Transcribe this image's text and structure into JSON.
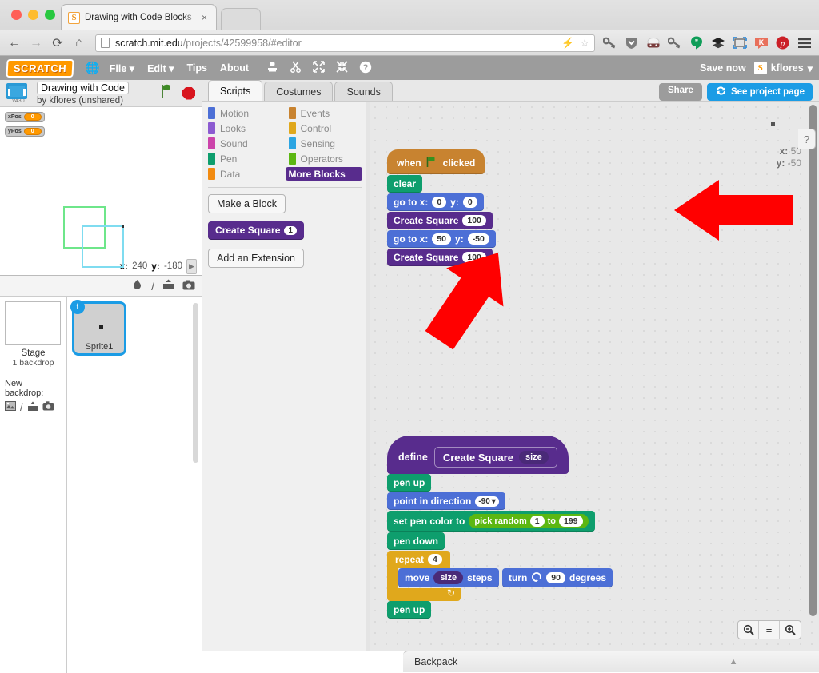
{
  "browser": {
    "tab_title": "Drawing with Code Blocks",
    "tab_favicon": "scratch-favicon",
    "tab_close": "×",
    "url_prefix": "scratch.mit.edu",
    "url_suffix": "/projects/42599958/#editor",
    "nav": {
      "back": "←",
      "forward": "→",
      "reload": "C",
      "home": "⌂"
    },
    "url_actions": {
      "bolt": "⚡",
      "star": "☆"
    },
    "extensions": [
      "key-icon",
      "shield-down-icon",
      "incognito-mask-icon",
      "key-icon-2",
      "hangouts-icon",
      "layers-icon",
      "screenshot-frame-icon",
      "klout-icon",
      "pinterest-icon",
      "menu-icon"
    ]
  },
  "menubar": {
    "logo": "SCRATCH",
    "globe_icon": "globe-icon",
    "items": [
      "File",
      "Edit",
      "Tips",
      "About"
    ],
    "tool_icons": [
      "stamp-icon",
      "scissors-icon",
      "grow-icon",
      "shrink-icon",
      "help-icon"
    ],
    "save_now": "Save now",
    "username": "kflores",
    "user_caret": "▾"
  },
  "stage": {
    "version": "v430",
    "project_title": "Drawing with Code",
    "author_line": "by kflores (unshared)",
    "green_flag": "green-flag-icon",
    "stop_sign": "stop-icon",
    "watchers": [
      {
        "name": "xPos",
        "value": "0"
      },
      {
        "name": "yPos",
        "value": "0"
      }
    ],
    "mouse_x_label": "x:",
    "mouse_x": "240",
    "mouse_y_label": "y:",
    "mouse_y": "-180",
    "drawing": {
      "square_green_color": "#6ee68a",
      "square_cyan_color": "#7fdcf0"
    }
  },
  "sprite_pane": {
    "toolbar_icons": [
      "new-sprite-paint-icon",
      "new-sprite-brush-icon",
      "upload-sprite-icon",
      "camera-sprite-icon"
    ],
    "stage_name": "Stage",
    "stage_sub": "1 backdrop",
    "new_backdrop_label": "New backdrop:",
    "backdrop_icons": [
      "library-backdrop-icon",
      "paint-backdrop-icon",
      "upload-backdrop-icon",
      "camera-backdrop-icon"
    ],
    "sprites": [
      {
        "name": "Sprite1",
        "info_badge": "i",
        "selected": true
      }
    ]
  },
  "editor": {
    "tabs": [
      {
        "label": "Scripts",
        "active": true
      },
      {
        "label": "Costumes",
        "active": false
      },
      {
        "label": "Sounds",
        "active": false
      }
    ],
    "share_button": "Share",
    "project_page_button": "See project page",
    "project_page_icon": "refresh-arrows-icon"
  },
  "palette": {
    "categories": [
      {
        "label": "Motion",
        "color": "#4c6fd6",
        "selected": false
      },
      {
        "label": "Events",
        "color": "#c88330",
        "selected": false
      },
      {
        "label": "Looks",
        "color": "#8c5bd1",
        "selected": false
      },
      {
        "label": "Control",
        "color": "#e0a81c",
        "selected": false
      },
      {
        "label": "Sound",
        "color": "#cc44aa",
        "selected": false
      },
      {
        "label": "Sensing",
        "color": "#2ca5e2",
        "selected": false
      },
      {
        "label": "Pen",
        "color": "#0e9e6d",
        "selected": false
      },
      {
        "label": "Operators",
        "color": "#5cb712",
        "selected": false
      },
      {
        "label": "Data",
        "color": "#f28b11",
        "selected": false
      },
      {
        "label": "More Blocks",
        "color": "#582c8d",
        "selected": true
      }
    ],
    "make_a_block": "Make a Block",
    "custom_block": {
      "label": "Create Square",
      "arg": "1"
    },
    "add_extension": "Add an Extension"
  },
  "canvas": {
    "sprite_x_label": "x:",
    "sprite_x": "50",
    "sprite_y_label": "y:",
    "sprite_y": "-50",
    "zoom_out": "zoom-out-icon",
    "zoom_reset": "=",
    "zoom_in": "zoom-in-icon",
    "help": "?"
  },
  "scripts": {
    "main": {
      "hat": {
        "when": "when",
        "flag": "green-flag-icon",
        "clicked": "clicked"
      },
      "blocks": [
        {
          "type": "pen",
          "text": "clear"
        },
        {
          "type": "motion",
          "text": "go to x:",
          "x": "0",
          "y_label": "y:",
          "y": "0"
        },
        {
          "type": "more",
          "text": "Create Square",
          "arg": "100"
        },
        {
          "type": "motion",
          "text": "go to x:",
          "x": "50",
          "y_label": "y:",
          "y": "-50"
        },
        {
          "type": "more",
          "text": "Create Square",
          "arg": "100"
        }
      ]
    },
    "definition": {
      "define_label": "define",
      "proc_name": "Create Square",
      "proc_param": "size",
      "body": [
        {
          "type": "pen",
          "text": "pen up"
        },
        {
          "type": "motion",
          "text": "point in direction",
          "value": "-90",
          "caret": "▾"
        },
        {
          "type": "pen",
          "text": "set pen color to",
          "op": "pick random",
          "from": "1",
          "to_label": "to",
          "to": "199"
        },
        {
          "type": "pen",
          "text": "pen down"
        },
        {
          "type": "control",
          "text": "repeat",
          "times": "4",
          "children": [
            {
              "type": "motion",
              "text": "move",
              "var": "size",
              "suffix": "steps"
            },
            {
              "type": "motion",
              "text": "turn",
              "icon": "turn-ccw-icon",
              "degrees": "90",
              "suffix": "degrees"
            }
          ]
        },
        {
          "type": "pen",
          "text": "pen up"
        }
      ]
    }
  },
  "annotations": {
    "arrow_color": "#ff0000",
    "arrow_canvas_label": "arrow-pointing-left-at-main-script",
    "arrow_palette_label": "arrow-pointing-up-left-at-custom-block"
  },
  "backpack": {
    "label": "Backpack",
    "toggle": "▲"
  }
}
